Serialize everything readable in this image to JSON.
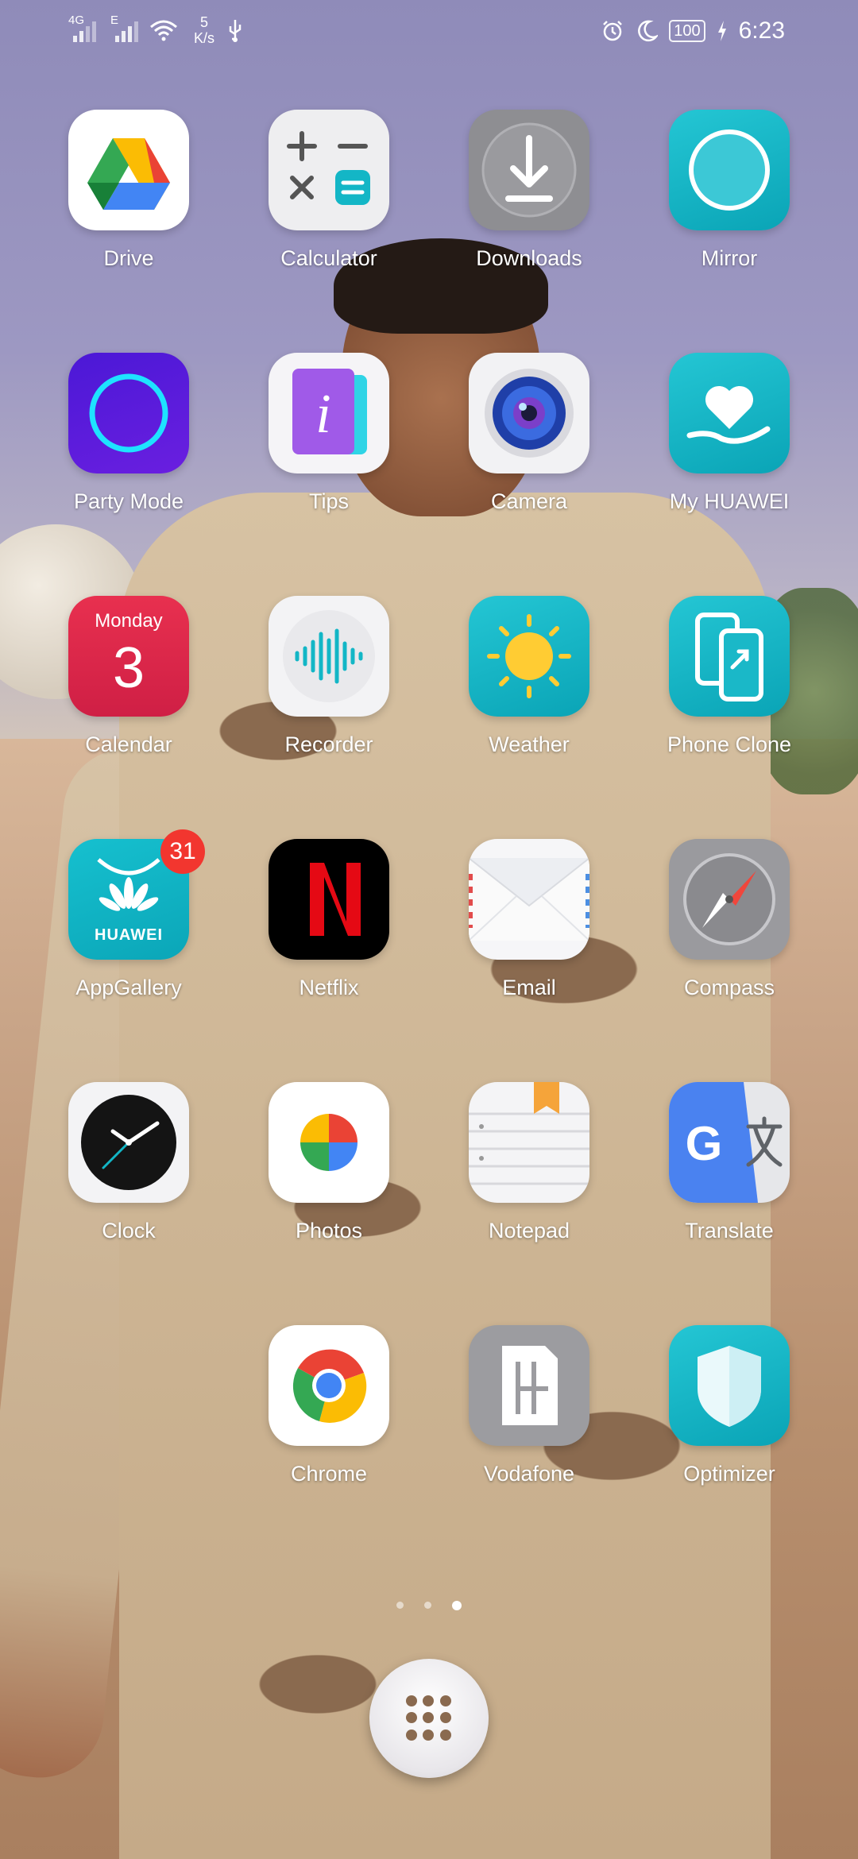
{
  "statusbar": {
    "signal1_type": "4G",
    "signal2_type": "E",
    "speed_value": "5",
    "speed_unit": "K/s",
    "battery": "100",
    "time": "6:23"
  },
  "apps": [
    {
      "label": "Drive"
    },
    {
      "label": "Calculator"
    },
    {
      "label": "Downloads"
    },
    {
      "label": "Mirror"
    },
    {
      "label": "Party Mode"
    },
    {
      "label": "Tips"
    },
    {
      "label": "Camera"
    },
    {
      "label": "My HUAWEI"
    },
    {
      "label": "Calendar",
      "day_name": "Monday",
      "day_number": "3"
    },
    {
      "label": "Recorder"
    },
    {
      "label": "Weather"
    },
    {
      "label": "Phone Clone"
    },
    {
      "label": "AppGallery",
      "badge": "31",
      "brand_text": "HUAWEI"
    },
    {
      "label": "Netflix"
    },
    {
      "label": "Email"
    },
    {
      "label": "Compass"
    },
    {
      "label": "Clock"
    },
    {
      "label": "Photos"
    },
    {
      "label": "Notepad"
    },
    {
      "label": "Translate"
    },
    {
      "label": "Chrome"
    },
    {
      "label": "Vodafone"
    },
    {
      "label": "Optimizer"
    }
  ],
  "page_indicator": {
    "count": 3,
    "active_index": 2
  },
  "colors": {
    "badge": "#f2362f",
    "huawei_teal": "#13b6c6",
    "netflix_red": "#e50914"
  }
}
